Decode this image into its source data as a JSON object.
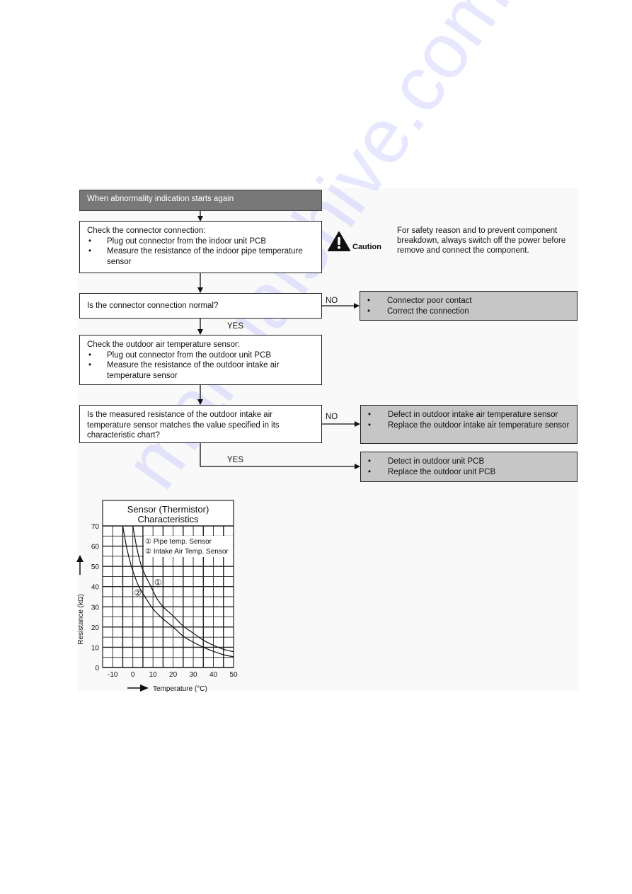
{
  "flowchart": {
    "start": "When abnormality indication starts again",
    "step1": {
      "title": "Check the connector connection:",
      "bullets": [
        "Plug out connector from the indoor unit PCB",
        "Measure the resistance of the indoor pipe temperature sensor"
      ]
    },
    "decision1": {
      "question": "Is the connector connection normal?",
      "no_label": "NO",
      "yes_label": "YES",
      "no_result": [
        "Connector poor contact",
        "Correct the connection"
      ]
    },
    "step2": {
      "title": "Check the outdoor air temperature sensor:",
      "bullets": [
        "Plug out connector from the outdoor unit PCB",
        "Measure the resistance of the outdoor intake air temperature sensor"
      ]
    },
    "decision2": {
      "question": "Is the measured resistance of the outdoor intake air temperature sensor matches the value specified in its characteristic chart?",
      "no_label": "NO",
      "yes_label": "YES",
      "no_result": [
        "Defect in outdoor intake air temperature sensor",
        "Replace the outdoor intake air temperature sensor"
      ],
      "yes_result": [
        "Detect in outdoor unit PCB",
        "Replace the outdoor unit PCB"
      ]
    }
  },
  "caution": {
    "icon": "warning-triangle-icon",
    "label": "Caution",
    "text": "For safety reason and to prevent component breakdown, always switch off the power before remove and connect the component."
  },
  "watermark": "manualshive.com",
  "chart_data": {
    "type": "line",
    "title": "Sensor (Thermistor) Characteristics",
    "title_lines": [
      "Sensor (Thermistor)",
      "Characteristics"
    ],
    "xlabel": "Temperature (°C)",
    "ylabel": "Resistance (kΩ)",
    "xlim": [
      -15,
      50
    ],
    "ylim": [
      0,
      70
    ],
    "xticks": [
      -10,
      0,
      10,
      20,
      30,
      40,
      50
    ],
    "yticks": [
      0,
      10,
      20,
      30,
      40,
      50,
      60,
      70
    ],
    "grid": true,
    "legend": [
      "① Pipe temp. Sensor",
      "② Intake Air Temp. Sensor"
    ],
    "legend_position": "top-right",
    "series": [
      {
        "name": "Pipe temp. Sensor",
        "marker_label": "①",
        "x": [
          0,
          2,
          4,
          6,
          9,
          12,
          15,
          20,
          25,
          30,
          35,
          40,
          45,
          50
        ],
        "y": [
          70,
          59,
          51,
          46,
          40,
          34,
          30,
          25.5,
          20.5,
          17,
          13.5,
          11,
          9,
          7.8
        ]
      },
      {
        "name": "Intake Air Temp. Sensor",
        "marker_label": "②",
        "x": [
          -5,
          -3,
          -1,
          1,
          3,
          6,
          10,
          15,
          20,
          25,
          30,
          35,
          40,
          45,
          50
        ],
        "y": [
          70,
          59,
          51,
          45,
          40,
          35,
          29,
          24,
          20,
          15.5,
          12.5,
          10,
          8,
          6.3,
          5.3
        ]
      }
    ]
  }
}
